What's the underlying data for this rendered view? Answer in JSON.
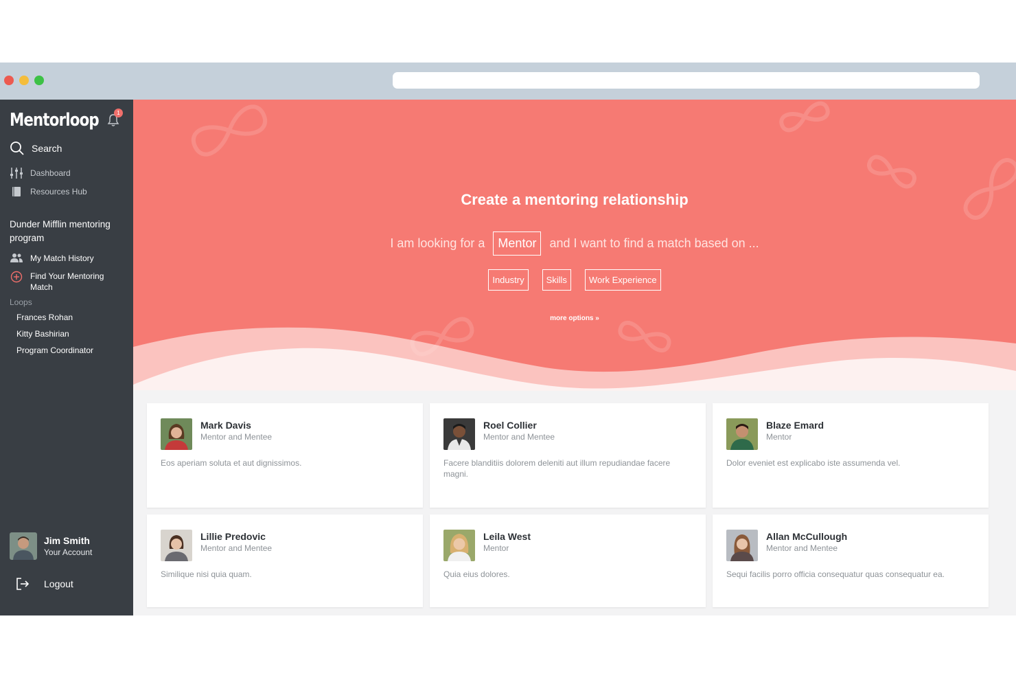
{
  "colors": {
    "accent": "#f67a73",
    "sidebar": "#393e44",
    "chrome": "#c5d0da"
  },
  "sidebar": {
    "logo": "Mentorloop",
    "notification_count": "1",
    "search_label": "Search",
    "nav": [
      {
        "label": "Dashboard",
        "icon": "sliders-icon"
      },
      {
        "label": "Resources Hub",
        "icon": "book-icon"
      }
    ],
    "program_title": "Dunder Mifflin mentoring program",
    "program_nav": [
      {
        "label": "My Match History",
        "icon": "users-icon"
      },
      {
        "label": "Find Your Mentoring Match",
        "icon": "plus-circle-icon"
      }
    ],
    "loops_label": "Loops",
    "loops": [
      "Frances Rohan",
      "Kitty Bashirian",
      "Program Coordinator"
    ],
    "user": {
      "name": "Jim Smith",
      "subtitle": "Your Account"
    },
    "logout_label": "Logout"
  },
  "hero": {
    "title": "Create a mentoring relationship",
    "prefix": "I am looking for a",
    "role_select": "Mentor",
    "suffix": "and I want to find a match based on ...",
    "criteria": [
      "Industry",
      "Skills",
      "Work Experience"
    ],
    "more_options": "more options »"
  },
  "profiles": [
    {
      "name": "Mark Davis",
      "role": "Mentor and Mentee",
      "bio": "Eos aperiam soluta et aut dignissimos."
    },
    {
      "name": "Roel Collier",
      "role": "Mentor and Mentee",
      "bio": "Facere blanditiis dolorem deleniti aut illum repudiandae facere magni."
    },
    {
      "name": "Blaze Emard",
      "role": "Mentor",
      "bio": "Dolor eveniet est explicabo iste assumenda vel."
    },
    {
      "name": "Lillie Predovic",
      "role": "Mentor and Mentee",
      "bio": "Similique nisi quia quam."
    },
    {
      "name": "Leila West",
      "role": "Mentor",
      "bio": "Quia eius dolores."
    },
    {
      "name": "Allan McCullough",
      "role": "Mentor and Mentee",
      "bio": "Sequi facilis porro officia consequatur quas consequatur ea."
    }
  ]
}
